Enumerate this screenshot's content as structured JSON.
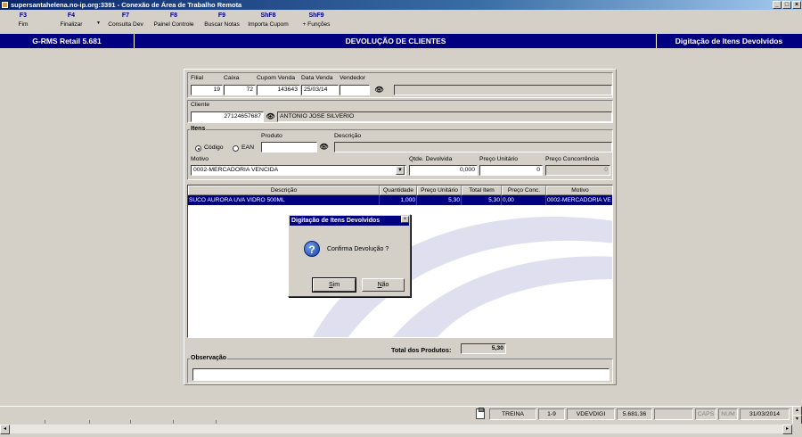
{
  "window": {
    "title": "supersantahelena.no-ip.org:3391 - Conexão de Área de Trabalho Remota",
    "buttons": [
      "_",
      "□",
      "×"
    ]
  },
  "fkeys": [
    {
      "key": "F3",
      "label": "Fim"
    },
    {
      "key": "F4",
      "label": "Finalizar"
    },
    {
      "key": "F7",
      "label": "Consulta Dev"
    },
    {
      "key": "F8",
      "label": "Painel Controle"
    },
    {
      "key": "F9",
      "label": "Buscar Notas"
    },
    {
      "key": "ShF8",
      "label": "Importa Cupom"
    },
    {
      "key": "ShF9",
      "label": "+ Funções"
    }
  ],
  "header": {
    "app": "G-RMS Retail 5.681",
    "screen": "DEVOLUÇÃO DE CLIENTES",
    "subscreen": "Digitação de Itens Devolvidos"
  },
  "sale": {
    "labels": {
      "filial": "Filial",
      "caixa": "Caixa",
      "cupom": "Cupom Venda",
      "data": "Data Venda",
      "vendedor": "Vendedor"
    },
    "filial": "19",
    "caixa": "72",
    "cupom": "143643",
    "data": "25/03/14",
    "vendedor": "",
    "vendedor_name": ""
  },
  "client": {
    "label": "Cliente",
    "code": "27124657687",
    "name": "ANTONIO JOSE SILVERIO"
  },
  "items": {
    "legend": "Itens",
    "produto_label": "Produto",
    "descricao_label": "Descrição",
    "radio_codigo": "Código",
    "radio_ean": "EAN",
    "produto": "",
    "descricao": "",
    "motivo_label": "Motivo",
    "motivo": "0002-MERCADORIA VENCIDA",
    "qtde_label": "Qtde. Devolvida",
    "qtde": "0,000",
    "preco_unit_label": "Preço Unitário",
    "preco_unit": "0",
    "preco_conc_label": "Preço Concorrência",
    "preco_conc": "0"
  },
  "grid": {
    "headers": [
      "Descrição",
      "Quantidade",
      "Preço Unitário",
      "Total Item",
      "Preço Conc.",
      "Motivo"
    ],
    "rows": [
      {
        "descricao": "SUCO AURORA UVA VIDRO 500ML",
        "quantidade": "1,000",
        "preco_unit": "5,30",
        "total": "5,30",
        "preco_conc": "0,00",
        "motivo": "0002-MERCADORIA VE"
      }
    ]
  },
  "totals": {
    "label": "Total dos Produtos:",
    "value": "5,30"
  },
  "observacao": {
    "legend": "Observação",
    "value": ""
  },
  "dialog": {
    "title": "Digitação de Itens Devolvidos",
    "close": "×",
    "icon": "question-icon",
    "message": "Confirma Devolução ?",
    "yes_prefix": "S",
    "yes_rest": "im",
    "no_prefix": "N",
    "no_rest": "ão"
  },
  "status": {
    "user": "TREINA",
    "range": "1-9",
    "module": "VDEVDIGI",
    "version": "5.681.36",
    "caps": "CAPS",
    "num": "NUM",
    "date": "31/03/2014"
  },
  "scroll": {
    "left": "◂",
    "right": "▸",
    "up": "▴",
    "down": "▾"
  }
}
